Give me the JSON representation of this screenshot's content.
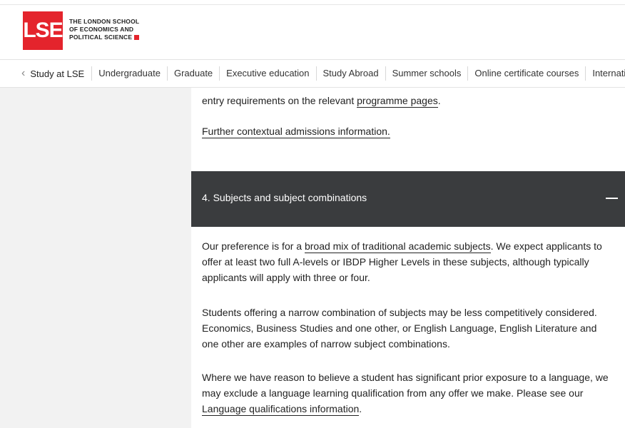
{
  "header": {
    "logo": "LSE",
    "logo_line1": "THE LONDON SCHOOL",
    "logo_line2": "OF ECONOMICS AND",
    "logo_line3": "POLITICAL SCIENCE"
  },
  "nav": {
    "back_label": "Study at LSE",
    "items": [
      "Undergraduate",
      "Graduate",
      "Executive education",
      "Study Abroad",
      "Summer schools",
      "Online certificate courses",
      "International"
    ]
  },
  "content": {
    "p0_text": "entry requirements on the relevant ",
    "p0_link": "programme pages",
    "p0_end": ".",
    "further_link": "Further contextual admissions information.",
    "accordion_title": "4. Subjects and subject combinations",
    "p1_a": "Our preference is for a ",
    "p1_link": "broad mix of traditional academic subjects",
    "p1_b": ". We expect applicants to offer at least two full A-levels or IBDP Higher Levels in these subjects, although typically applicants will apply with three or four.",
    "p2": "Students offering a narrow combination of subjects may be less competitively considered. Economics, Business Studies and one other, or English Language, English Literature and one other are examples of narrow subject combinations.",
    "p3_a": "Where we have reason to believe a student has significant prior exposure to a language, we may exclude a language learning qualification from any offer we make. Please see our ",
    "p3_link": "Language qualifications information",
    "p3_end": "."
  }
}
